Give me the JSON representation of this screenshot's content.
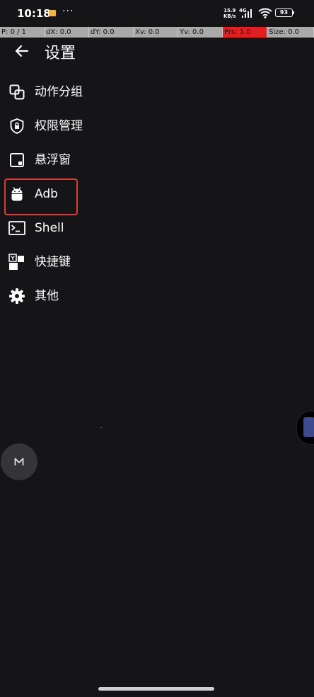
{
  "status_bar": {
    "time": "10:18",
    "more": "···",
    "net_speed_value": "15.9",
    "net_speed_unit": "KB/s",
    "network_type": "4G",
    "battery": "93"
  },
  "pointer_location": {
    "p": "P: 0 / 1",
    "dx": "dX: 0.0",
    "dy": "dY: 0.0",
    "xv": "Xv: 0.0",
    "yv": "Yv: 0.0",
    "prs": "Prs: 1.0",
    "size": "Size: 0.0"
  },
  "header": {
    "title": "设置"
  },
  "menu": {
    "items": [
      {
        "label": "动作分组",
        "icon": "layers-icon"
      },
      {
        "label": "权限管理",
        "icon": "shield-lock-icon"
      },
      {
        "label": "悬浮窗",
        "icon": "floating-window-icon"
      },
      {
        "label": "Adb",
        "icon": "android-icon"
      },
      {
        "label": "Shell",
        "icon": "terminal-icon"
      },
      {
        "label": "快捷键",
        "icon": "shortcut-icon"
      },
      {
        "label": "其他",
        "icon": "gear-icon"
      }
    ]
  },
  "colors": {
    "background": "#151518",
    "highlight": "#e53935",
    "pressure_cell": "#e02020"
  }
}
